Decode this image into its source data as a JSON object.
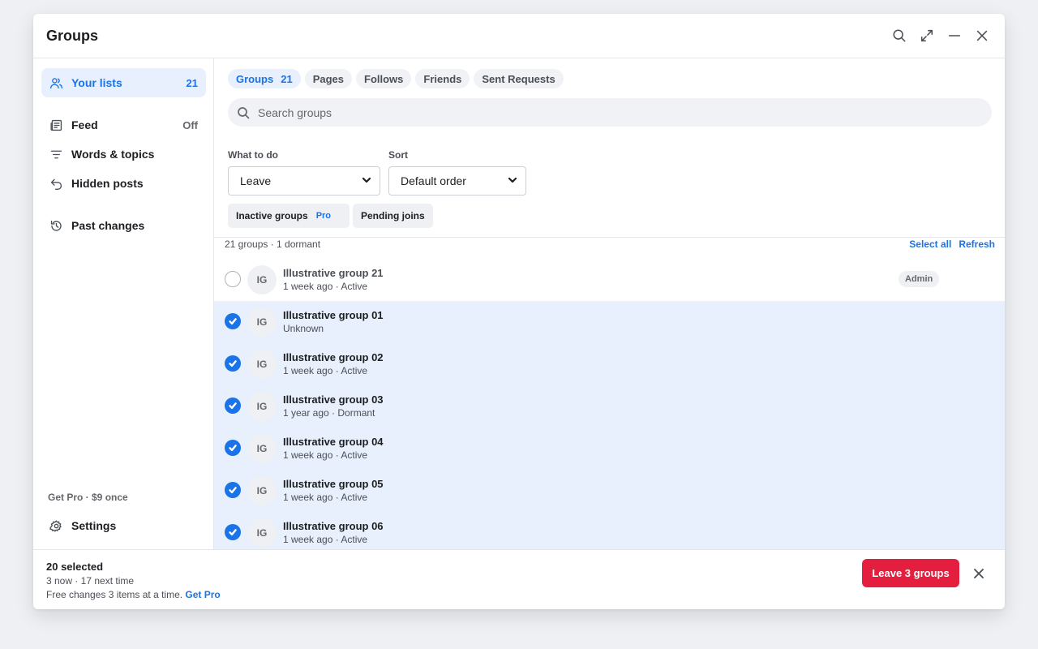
{
  "window": {
    "title": "Groups"
  },
  "sidebar": {
    "items": [
      {
        "label": "Your lists",
        "value": "21",
        "icon": "users-icon",
        "active": true
      },
      {
        "label": "Feed",
        "value": "Off",
        "icon": "newspaper-icon"
      },
      {
        "label": "Words & topics",
        "value": "",
        "icon": "filter-lines-icon"
      },
      {
        "label": "Hidden posts",
        "value": "",
        "icon": "undo-icon"
      },
      {
        "label": "Past changes",
        "value": "",
        "icon": "history-icon"
      }
    ],
    "get_pro": "Get Pro · $9 once",
    "settings": {
      "label": "Settings",
      "icon": "gear-icon"
    }
  },
  "tabs": [
    {
      "label": "Groups",
      "count": "21",
      "active": true
    },
    {
      "label": "Pages"
    },
    {
      "label": "Follows"
    },
    {
      "label": "Friends"
    },
    {
      "label": "Sent Requests"
    }
  ],
  "search": {
    "placeholder": "Search groups",
    "value": ""
  },
  "filters": {
    "action": {
      "label": "What to do",
      "value": "Leave"
    },
    "sort": {
      "label": "Sort",
      "value": "Default order"
    }
  },
  "chips": [
    {
      "label": "Inactive groups",
      "badge": "Pro"
    },
    {
      "label": "Pending joins"
    }
  ],
  "list": {
    "summary": "21 groups · 1 dormant",
    "select_all": "Select all",
    "refresh": "Refresh",
    "rows": [
      {
        "name": "Illustrative group 21",
        "meta": "1 week ago · Active",
        "initials": "IG",
        "selected": false,
        "badge": "Admin"
      },
      {
        "name": "Illustrative group 01",
        "meta": "Unknown",
        "initials": "IG",
        "selected": true
      },
      {
        "name": "Illustrative group 02",
        "meta": "1 week ago · Active",
        "initials": "IG",
        "selected": true
      },
      {
        "name": "Illustrative group 03",
        "meta": "1 year ago · Dormant",
        "initials": "IG",
        "selected": true
      },
      {
        "name": "Illustrative group 04",
        "meta": "1 week ago · Active",
        "initials": "IG",
        "selected": true
      },
      {
        "name": "Illustrative group 05",
        "meta": "1 week ago · Active",
        "initials": "IG",
        "selected": true
      },
      {
        "name": "Illustrative group 06",
        "meta": "1 week ago · Active",
        "initials": "IG",
        "selected": true
      }
    ]
  },
  "footer": {
    "selected": "20 selected",
    "detail": "3 now · 17 next time",
    "note": "Free changes 3 items at a time.",
    "note_link": "Get Pro",
    "action_button": "Leave 3 groups"
  },
  "colors": {
    "accent": "#1a73e8",
    "danger": "#e41e3f",
    "selected_row": "#e7f0fc"
  }
}
